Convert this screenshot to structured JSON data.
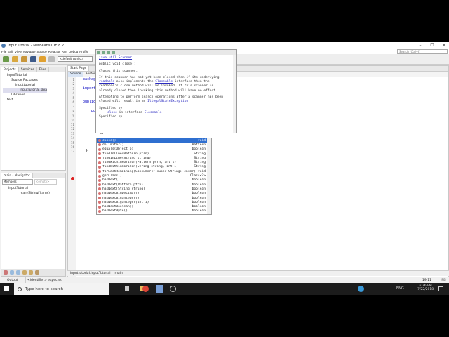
{
  "window": {
    "title": "InputTutorial - NetBeans IDE 8.2",
    "minimize": "–",
    "restore": "❐",
    "close": "✕"
  },
  "menu": [
    "File",
    "Edit",
    "View",
    "Navigate",
    "Source",
    "Refactor",
    "Run",
    "Debug",
    "Profile"
  ],
  "search_placeholder": "Search (Ctrl+I)",
  "toolbar": {
    "config": "<default config>"
  },
  "projects": {
    "tabs": [
      "Projects",
      "Services",
      "Files"
    ],
    "tree": [
      "InputTutorial",
      "Source Packages",
      "inputtutorial",
      "InputTutorial.java",
      "Libraries",
      "test"
    ]
  },
  "navigator": {
    "title": "main - Navigator",
    "filter": "Members",
    "empty": "<empty>",
    "tree": [
      "InputTutorial",
      "main(String[] args)"
    ]
  },
  "editor": {
    "tabs": [
      "Start Page"
    ],
    "subtabs": [
      "Source",
      "History"
    ],
    "lines": [
      "1",
      "2",
      "3",
      "4",
      "5",
      "6",
      "7",
      "8",
      "9",
      "10",
      "11",
      "12",
      "13",
      "14",
      "15",
      "16",
      "17"
    ],
    "code": {
      "l1": "package",
      "l3": "import",
      "l6": "public",
      "l8": "public",
      "l13": "s.",
      "l15": "}",
      "l17": "}"
    }
  },
  "doc": {
    "class_link": "java.util.Scanner",
    "signature": "public void close()",
    "summary": "Closes this scanner.",
    "p1a": "If this scanner has not yet been closed then if its underlying",
    "p1_link1": "readable",
    "p1b": " also implements the ",
    "p1_link2": "Closeable",
    "p1c": " interface then the",
    "p1d": "readable's close method will be invoked. If this scanner is",
    "p1e": "already closed then invoking this method will have no effect.",
    "p2a": "Attempting to perform search operations after a scanner has been",
    "p2b": "closed will result in an ",
    "p2_link": "IllegalStateException",
    "p2c": ".",
    "spec1": "Specified by:",
    "spec1_link": "close",
    "spec1_mid": " in interface ",
    "spec1_link2": "Closeable",
    "spec2": "Specified by:"
  },
  "completion": [
    {
      "name": "close()",
      "type": "void"
    },
    {
      "name": "delimiter()",
      "type": "Pattern"
    },
    {
      "name": "equals(Object o)",
      "type": "boolean"
    },
    {
      "name": "findInLine(Pattern ptrn)",
      "type": "String"
    },
    {
      "name": "findInLine(String string)",
      "type": "String"
    },
    {
      "name": "findWithinHorizon(Pattern ptrn, int i)",
      "type": "String"
    },
    {
      "name": "findWithinHorizon(String string, int i)",
      "type": "String"
    },
    {
      "name": "forEachRemaining(Consumer<? super String> cnsmr)",
      "type": "void"
    },
    {
      "name": "getClass()",
      "type": "Class<?>"
    },
    {
      "name": "hasNext()",
      "type": "boolean"
    },
    {
      "name": "hasNext(Pattern ptrn)",
      "type": "boolean"
    },
    {
      "name": "hasNext(String string)",
      "type": "boolean"
    },
    {
      "name": "hasNextBigDecimal()",
      "type": "boolean"
    },
    {
      "name": "hasNextBigInteger()",
      "type": "boolean"
    },
    {
      "name": "hasNextBigInteger(int i)",
      "type": "boolean"
    },
    {
      "name": "hasNextBoolean()",
      "type": "boolean"
    },
    {
      "name": "hasNextByte()",
      "type": "boolean"
    }
  ],
  "breadcrumb": [
    "inputtutorial.InputTutorial",
    "main"
  ],
  "status": {
    "output": "Output",
    "message": "<identifier> expected",
    "position": "19:11",
    "mode": "INS"
  },
  "taskbar": {
    "search": "Type here to search",
    "time": "6:36 PM",
    "date": "7/22/2018",
    "lang": "ENG"
  }
}
